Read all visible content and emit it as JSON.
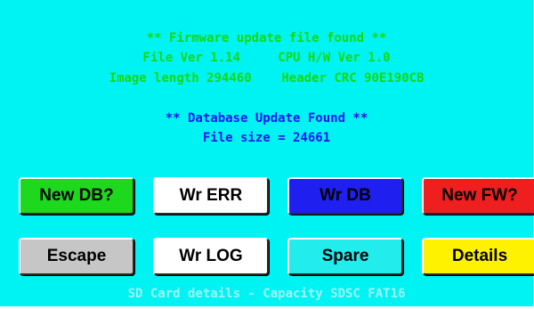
{
  "firmware": {
    "header": "** Firmware update file found **",
    "versions": "File Ver 1.14     CPU H/W Ver 1.0",
    "image_info": "Image length 294460    Header CRC 90E190CB"
  },
  "database": {
    "header": "** Database Update Found **",
    "file_size": "File size = 24661"
  },
  "buttons": {
    "new_db": "New DB?",
    "wr_err": "Wr ERR",
    "wr_db": "Wr DB",
    "new_fw": "New FW?",
    "escape": "Escape",
    "wr_log": "Wr LOG",
    "spare": "Spare",
    "details": "Details"
  },
  "footer": "SD Card details - Capacity SDSC FAT16",
  "colors": {
    "background": "#00f3f3",
    "firmware_text": "#12d812",
    "database_text": "#1818ee",
    "footer_text": "#9ef6f6",
    "new_db": "#1ed81e",
    "wr_err": "#ffffff",
    "wr_db": "#1f1ff0",
    "new_fw": "#f01f1f",
    "escape": "#c6c6c6",
    "wr_log": "#ffffff",
    "spare": "#22ecec",
    "details": "#fff200"
  }
}
